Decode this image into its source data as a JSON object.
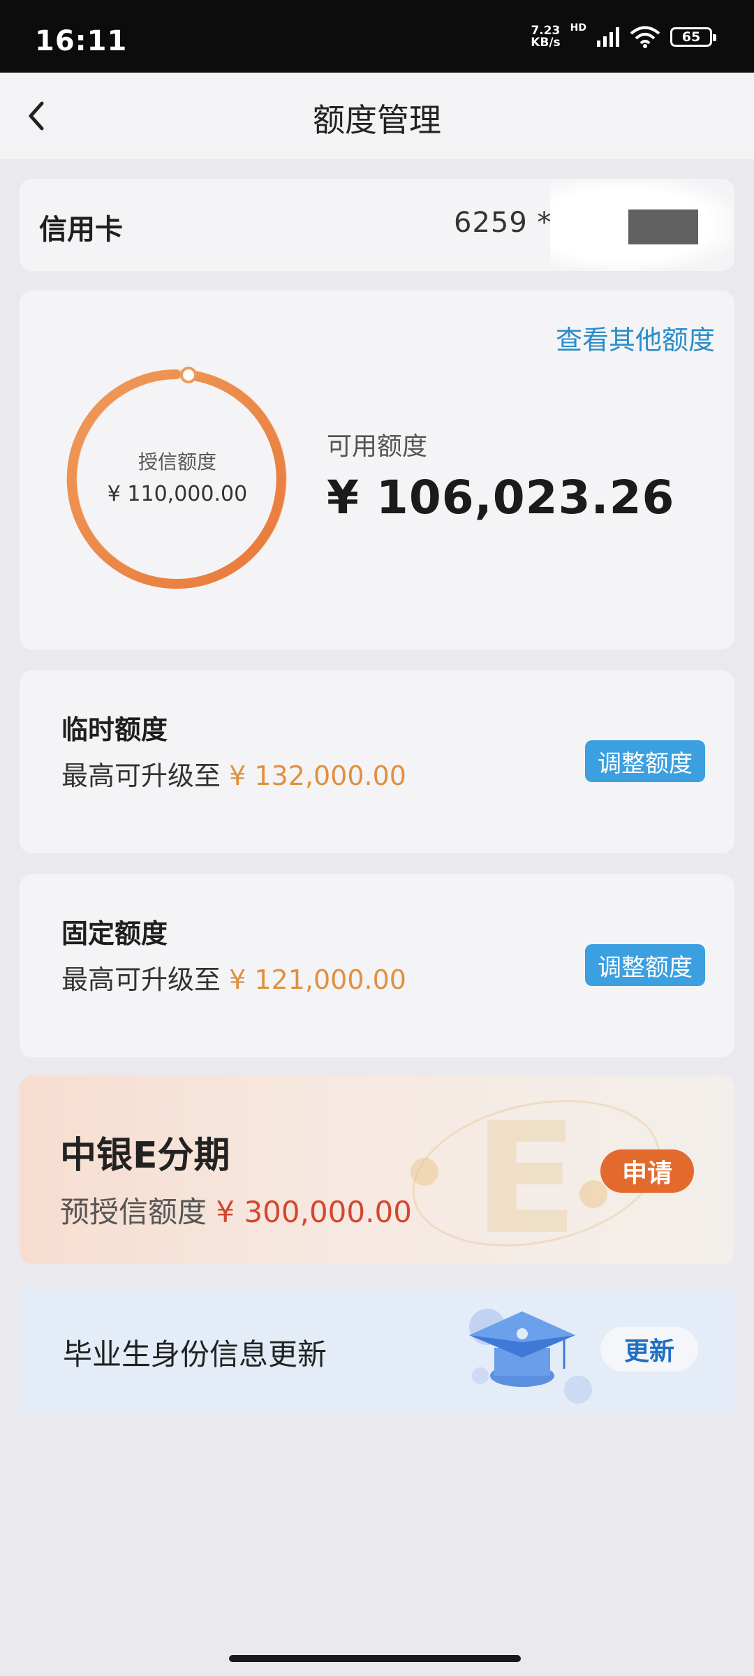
{
  "status_bar": {
    "time": "16:11",
    "net_speed_value": "7.23",
    "net_speed_unit": "KB/s",
    "hd_label": "HD",
    "battery": "65"
  },
  "header": {
    "title": "额度管理",
    "back_icon": "chevron-left-icon"
  },
  "card_info": {
    "label": "信用卡",
    "number_visible": "6259 *"
  },
  "limit": {
    "other_limits_link": "查看其他额度",
    "credit_label": "授信额度",
    "credit_value": "¥ 110,000.00",
    "available_label": "可用额度",
    "available_value": "¥ 106,023.26",
    "ring_color": "#ec8a48"
  },
  "temporary_limit": {
    "title": "临时额度",
    "prefix": "最高可升级至",
    "amount": "¥ 132,000.00",
    "button": "调整额度"
  },
  "fixed_limit": {
    "title": "固定额度",
    "prefix": "最高可升级至",
    "amount": "¥ 121,000.00",
    "button": "调整额度"
  },
  "installment_promo": {
    "title": "中银E分期",
    "prefix": "预授信额度",
    "amount": "¥ 300,000.00",
    "button": "申请"
  },
  "graduate_update": {
    "title": "毕业生身份信息更新",
    "button": "更新",
    "icon": "graduation-cap-icon"
  },
  "colors": {
    "accent_blue": "#3b9fe0",
    "amount_orange": "#e0903f",
    "apply_orange": "#e26a2c"
  }
}
